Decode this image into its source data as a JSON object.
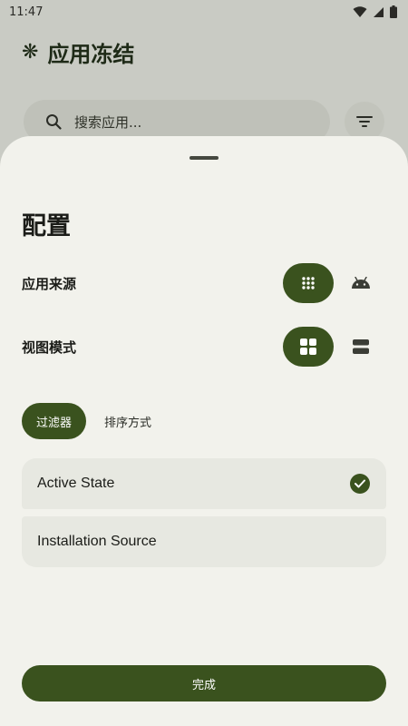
{
  "status_bar": {
    "time": "11:47"
  },
  "app": {
    "title": "应用冻结",
    "logo_icon": "snowflake-icon"
  },
  "search": {
    "placeholder": "搜索应用..."
  },
  "sheet": {
    "title": "配置",
    "app_source": {
      "label": "应用来源",
      "selected_icon": "apps-grid-icon",
      "other_icon": "android-icon"
    },
    "view_mode": {
      "label": "视图模式",
      "selected_icon": "grid-view-icon",
      "other_icon": "list-view-icon"
    },
    "tabs": [
      {
        "label": "过滤器",
        "selected": true
      },
      {
        "label": "排序方式",
        "selected": false
      }
    ],
    "options": [
      {
        "label": "Active State",
        "checked": true
      },
      {
        "label": "Installation Source",
        "checked": false
      }
    ],
    "done_label": "完成"
  },
  "colors": {
    "primary": "#3a521e",
    "sheet_bg": "#f2f2ec",
    "card_bg": "#e7e8e1",
    "scrim_bg": "#c9cbc4"
  }
}
